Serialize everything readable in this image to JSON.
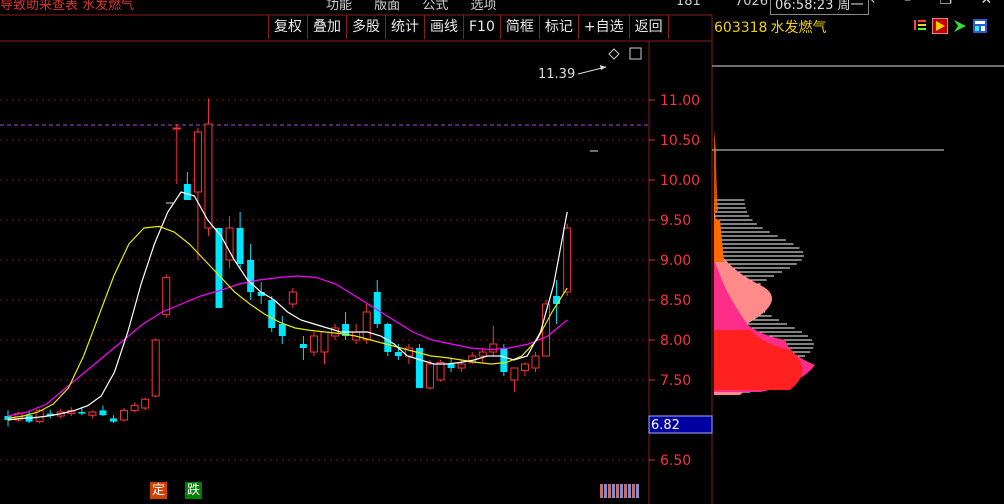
{
  "app": {
    "title": "导致助来查表 水发燃气",
    "menu": [
      "功能",
      "版面",
      "公式",
      "选项"
    ],
    "nums": [
      "181",
      "7026"
    ],
    "clock": "06:58:23 周一",
    "window_buttons": [
      "‹",
      "–",
      "❐",
      "✕"
    ]
  },
  "toolbar": {
    "items": [
      "复权",
      "叠加",
      "多股",
      "统计",
      "画线",
      "F10",
      "简框",
      "标记",
      "+自选",
      "返回"
    ]
  },
  "stock": {
    "code": "603318",
    "name": "水发燃气"
  },
  "icons": {
    "list": "list-icon",
    "play": "play-icon",
    "arrow": "green-arrow-icon",
    "layout": "layout-icon"
  },
  "colors": {
    "up": "#ff3232",
    "down": "#00e5ff",
    "ma5": "#ffffff",
    "ma10": "#e8e800",
    "ma20": "#ff00ff",
    "border": "#8b1a1a"
  },
  "price_axis": {
    "ticks": [
      "11.00",
      "10.50",
      "10.00",
      "9.50",
      "9.00",
      "8.50",
      "8.00",
      "7.50",
      "6.50"
    ]
  },
  "annotations": {
    "max_label": "11.39",
    "cross_price": "6.82"
  },
  "bottom_tags": {
    "ding": "定",
    "die": "跌"
  },
  "chart_data": {
    "type": "candlestick",
    "y_ticks": [
      11.0,
      10.5,
      10.0,
      9.5,
      9.0,
      8.5,
      8.0,
      7.5,
      6.5
    ],
    "candles": [
      {
        "o": 7.05,
        "h": 7.12,
        "l": 6.92,
        "c": 7.0
      },
      {
        "o": 7.0,
        "h": 7.1,
        "l": 6.98,
        "c": 7.08
      },
      {
        "o": 7.06,
        "h": 7.12,
        "l": 6.96,
        "c": 6.98
      },
      {
        "o": 6.98,
        "h": 7.14,
        "l": 6.96,
        "c": 7.12
      },
      {
        "o": 7.08,
        "h": 7.13,
        "l": 7.02,
        "c": 7.05
      },
      {
        "o": 7.05,
        "h": 7.14,
        "l": 7.02,
        "c": 7.1
      },
      {
        "o": 7.08,
        "h": 7.16,
        "l": 7.05,
        "c": 7.12
      },
      {
        "o": 7.1,
        "h": 7.16,
        "l": 7.06,
        "c": 7.08
      },
      {
        "o": 7.06,
        "h": 7.12,
        "l": 7.02,
        "c": 7.1
      },
      {
        "o": 7.12,
        "h": 7.18,
        "l": 7.05,
        "c": 7.06
      },
      {
        "o": 7.02,
        "h": 7.06,
        "l": 6.96,
        "c": 6.98
      },
      {
        "o": 7.0,
        "h": 7.15,
        "l": 6.98,
        "c": 7.12
      },
      {
        "o": 7.12,
        "h": 7.22,
        "l": 7.1,
        "c": 7.18
      },
      {
        "o": 7.15,
        "h": 7.28,
        "l": 7.12,
        "c": 7.26
      },
      {
        "o": 7.3,
        "h": 8.02,
        "l": 7.28,
        "c": 8.0
      },
      {
        "o": 8.32,
        "h": 8.82,
        "l": 8.28,
        "c": 8.78
      },
      {
        "o": 10.65,
        "h": 10.7,
        "l": 9.95,
        "c": 10.65
      },
      {
        "o": 9.95,
        "h": 10.1,
        "l": 9.75,
        "c": 9.75
      },
      {
        "o": 9.85,
        "h": 10.65,
        "l": 9.0,
        "c": 10.6
      },
      {
        "o": 9.4,
        "h": 11.02,
        "l": 9.3,
        "c": 10.7
      },
      {
        "o": 9.4,
        "h": 9.4,
        "l": 8.4,
        "c": 8.4
      },
      {
        "o": 9.0,
        "h": 9.55,
        "l": 8.9,
        "c": 9.4
      },
      {
        "o": 9.4,
        "h": 9.6,
        "l": 8.9,
        "c": 8.95
      },
      {
        "o": 9.0,
        "h": 9.2,
        "l": 8.5,
        "c": 8.6
      },
      {
        "o": 8.6,
        "h": 8.72,
        "l": 8.45,
        "c": 8.55
      },
      {
        "o": 8.5,
        "h": 8.55,
        "l": 8.1,
        "c": 8.15
      },
      {
        "o": 8.2,
        "h": 8.3,
        "l": 7.95,
        "c": 8.05
      },
      {
        "o": 8.45,
        "h": 8.65,
        "l": 8.4,
        "c": 8.6
      },
      {
        "o": 7.95,
        "h": 8.05,
        "l": 7.75,
        "c": 7.9
      },
      {
        "o": 7.85,
        "h": 8.1,
        "l": 7.8,
        "c": 8.05
      },
      {
        "o": 7.85,
        "h": 8.1,
        "l": 7.7,
        "c": 8.1
      },
      {
        "o": 8.05,
        "h": 8.2,
        "l": 8.0,
        "c": 8.15
      },
      {
        "o": 8.2,
        "h": 8.35,
        "l": 8.0,
        "c": 8.05
      },
      {
        "o": 8.0,
        "h": 8.2,
        "l": 7.95,
        "c": 8.1
      },
      {
        "o": 8.0,
        "h": 8.45,
        "l": 7.95,
        "c": 8.35
      },
      {
        "o": 8.6,
        "h": 8.75,
        "l": 8.15,
        "c": 8.2
      },
      {
        "o": 8.2,
        "h": 8.22,
        "l": 7.8,
        "c": 7.85
      },
      {
        "o": 7.85,
        "h": 7.95,
        "l": 7.75,
        "c": 7.8
      },
      {
        "o": 7.8,
        "h": 7.95,
        "l": 7.7,
        "c": 7.9
      },
      {
        "o": 7.9,
        "h": 7.95,
        "l": 7.4,
        "c": 7.4
      },
      {
        "o": 7.4,
        "h": 7.75,
        "l": 7.38,
        "c": 7.7
      },
      {
        "o": 7.5,
        "h": 7.75,
        "l": 7.48,
        "c": 7.72
      },
      {
        "o": 7.7,
        "h": 7.78,
        "l": 7.6,
        "c": 7.65
      },
      {
        "o": 7.65,
        "h": 7.75,
        "l": 7.6,
        "c": 7.7
      },
      {
        "o": 7.72,
        "h": 7.85,
        "l": 7.7,
        "c": 7.8
      },
      {
        "o": 7.8,
        "h": 7.9,
        "l": 7.72,
        "c": 7.85
      },
      {
        "o": 7.85,
        "h": 8.18,
        "l": 7.8,
        "c": 7.95
      },
      {
        "o": 7.9,
        "h": 7.95,
        "l": 7.55,
        "c": 7.6
      },
      {
        "o": 7.5,
        "h": 7.65,
        "l": 7.35,
        "c": 7.65
      },
      {
        "o": 7.62,
        "h": 7.72,
        "l": 7.55,
        "c": 7.7
      },
      {
        "o": 7.65,
        "h": 7.85,
        "l": 7.6,
        "c": 7.8
      },
      {
        "o": 7.8,
        "h": 8.5,
        "l": 7.8,
        "c": 8.45
      },
      {
        "o": 8.55,
        "h": 8.75,
        "l": 8.2,
        "c": 8.45
      },
      {
        "o": 8.6,
        "h": 9.45,
        "l": 8.55,
        "c": 9.4
      }
    ],
    "ma5": [
      7.0,
      7.02,
      7.03,
      7.05,
      7.08,
      7.12,
      7.18,
      7.3,
      7.6,
      8.1,
      8.7,
      9.2,
      9.6,
      9.85,
      9.8,
      9.5,
      9.3,
      9.0,
      8.75,
      8.6,
      8.5,
      8.35,
      8.25,
      8.2,
      8.15,
      8.1,
      8.1,
      8.1,
      8.05,
      7.95,
      7.8,
      7.75,
      7.7,
      7.7,
      7.72,
      7.75,
      7.8,
      7.8,
      7.75,
      7.8,
      8.1,
      8.7,
      9.6
    ],
    "ma10": [
      7.02,
      7.05,
      7.1,
      7.2,
      7.4,
      7.8,
      8.3,
      8.8,
      9.2,
      9.4,
      9.42,
      9.35,
      9.2,
      9.0,
      8.8,
      8.6,
      8.45,
      8.32,
      8.22,
      8.15,
      8.12,
      8.1,
      8.08,
      8.05,
      8.0,
      7.95,
      7.9,
      7.85,
      7.8,
      7.78,
      7.75,
      7.72,
      7.7,
      7.72,
      7.8,
      8.0,
      8.35,
      8.65
    ],
    "ma20": [
      7.05,
      7.1,
      7.2,
      7.4,
      7.6,
      7.8,
      8.0,
      8.2,
      8.35,
      8.45,
      8.55,
      8.62,
      8.7,
      8.75,
      8.78,
      8.8,
      8.78,
      8.7,
      8.55,
      8.4,
      8.25,
      8.1,
      8.0,
      7.95,
      7.9,
      7.88,
      7.9,
      7.95,
      8.05,
      8.25
    ]
  }
}
